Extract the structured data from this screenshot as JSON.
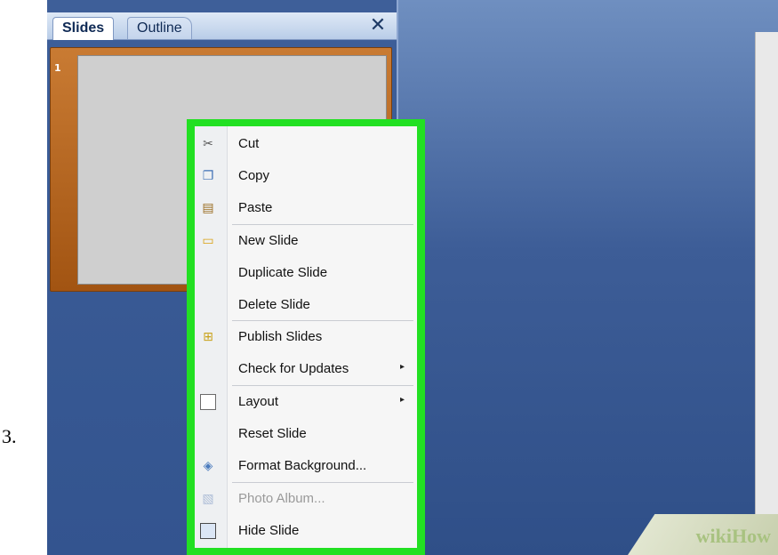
{
  "step_number": "3.",
  "panel": {
    "tabs": [
      {
        "label": "Slides",
        "active": true
      },
      {
        "label": "Outline",
        "active": false
      }
    ],
    "close_glyph": "✕",
    "slide_number": "1"
  },
  "context_menu": {
    "highlight_color": "#22e022",
    "items": [
      {
        "label": "Cut",
        "icon": "scissors-icon",
        "disabled": false
      },
      {
        "label": "Copy",
        "icon": "copy-icon",
        "disabled": false
      },
      {
        "label": "Paste",
        "icon": "paste-icon",
        "disabled": false
      },
      {
        "label": "New Slide",
        "icon": "new-slide-icon",
        "disabled": false
      },
      {
        "label": "Duplicate Slide",
        "icon": null,
        "disabled": false
      },
      {
        "label": "Delete Slide",
        "icon": null,
        "disabled": false
      },
      {
        "label": "Publish Slides",
        "icon": "publish-slides-icon",
        "disabled": false
      },
      {
        "label": "Check for Updates",
        "icon": null,
        "disabled": false,
        "submenu": true
      },
      {
        "label": "Layout",
        "icon": "layout-icon",
        "disabled": false,
        "submenu": true
      },
      {
        "label": "Reset Slide",
        "icon": null,
        "disabled": false
      },
      {
        "label": "Format Background...",
        "icon": "format-background-icon",
        "disabled": false
      },
      {
        "label": "Photo Album...",
        "icon": "photo-album-icon",
        "disabled": true
      },
      {
        "label": "Hide Slide",
        "icon": "hide-slide-icon",
        "disabled": false
      }
    ],
    "submenu_glyph": "▸"
  },
  "watermark": {
    "part1": "wiki",
    "part2": "How"
  }
}
